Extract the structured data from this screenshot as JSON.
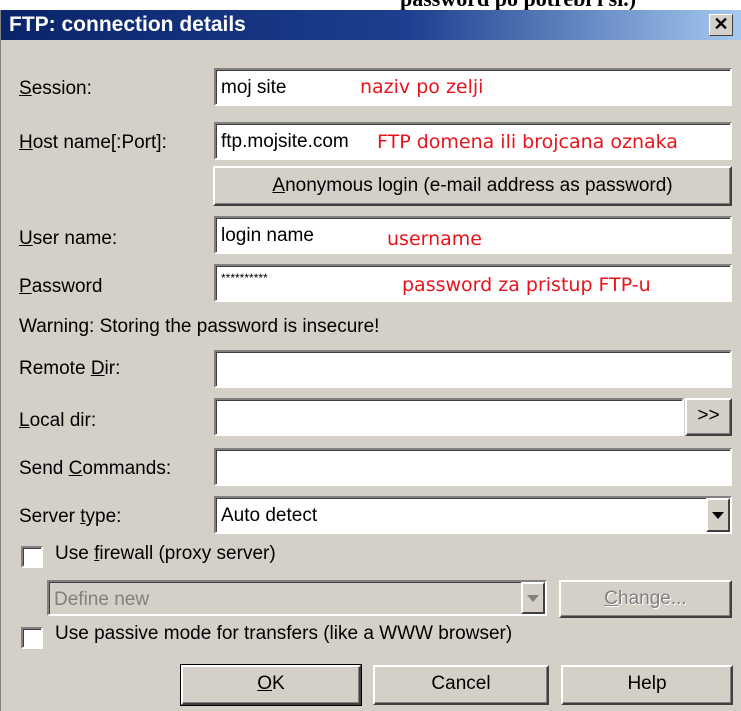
{
  "top_caption": "password po potrebi i sl.)",
  "dialog": {
    "title": "FTP: connection details",
    "close_label": "✕"
  },
  "fields": {
    "session": {
      "label": "Session:",
      "mnemonic": "S",
      "rest": "ession:",
      "value": "moj site",
      "note": "naziv po zelji"
    },
    "host": {
      "label": "Host name[:Port]:",
      "mnemonic": "H",
      "rest": "ost name[:Port]:",
      "value": "ftp.mojsite.com",
      "note": "FTP domena ili brojcana oznaka"
    },
    "anonymous_button": {
      "pre": "",
      "mnemonic": "A",
      "rest": "nonymous login (e-mail address as password)"
    },
    "user": {
      "label": "User name:",
      "mnemonic": "U",
      "rest": "ser name:",
      "value": "login name",
      "note": "username"
    },
    "password": {
      "label": "Password",
      "mnemonic": "P",
      "rest": "assword",
      "value": "**********",
      "note": "password za pristup FTP-u"
    },
    "warning": "Warning: Storing the password is insecure!",
    "remote_dir": {
      "pre": "Remote ",
      "mnemonic": "D",
      "rest": "ir:",
      "value": ""
    },
    "local_dir": {
      "pre": "",
      "mnemonic": "L",
      "rest": "ocal dir:",
      "value": "",
      "browse_label": ">>"
    },
    "send_commands": {
      "pre": "Send ",
      "mnemonic": "C",
      "rest": "ommands:",
      "value": ""
    },
    "server_type": {
      "pre": "Server ",
      "mnemonic": "t",
      "rest": "ype:",
      "value": "Auto detect"
    }
  },
  "firewall": {
    "checkbox_pre": "Use ",
    "checkbox_mnemonic": "f",
    "checkbox_rest": "irewall (proxy server)",
    "checked": false,
    "select_value": "Define new",
    "change_mnemonic": "C",
    "change_rest": "hange..."
  },
  "passive": {
    "label": "Use passive mode for transfers (like a WWW browser)",
    "checked": false
  },
  "buttons": {
    "ok_mnemonic": "O",
    "ok_rest": "K",
    "cancel": "Cancel",
    "help": "Help"
  }
}
